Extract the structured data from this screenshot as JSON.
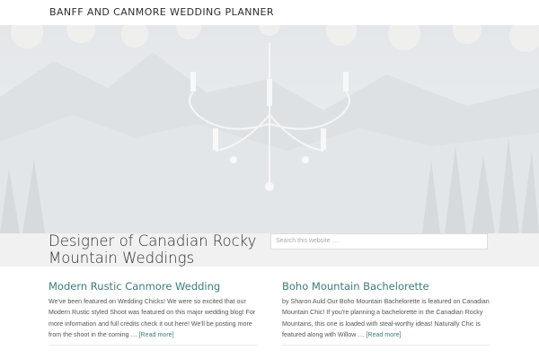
{
  "site": {
    "title": "BANFF AND CANMORE WEDDING PLANNER"
  },
  "intro": {
    "tagline": "Designer of Canadian Rocky Mountain Weddings",
    "search_placeholder": "Search this website …"
  },
  "posts": [
    {
      "title": "Modern Rustic Canmore Wedding",
      "excerpt": "We've been featured on Wedding Chicks! We were so excited that our Modern Rustic styled Shoot was featured on this major wedding blog! For more information and full credits check it out here! We'll be posting more from the shoot in the coming …",
      "read_more": "[Read more]"
    },
    {
      "title": "Boho Mountain Bachelorette",
      "excerpt": "by Sharon Auld Our Boho Mountain Bachelorette is featured on Canadian Mountain Chic! If you're planning a bachelorette in the Canadian Rocky Mountains, this one is loaded with steal-worthy ideas! Naturally Chic is featured along with Willow …",
      "read_more": "[Read more]"
    }
  ],
  "colors": {
    "accent": "#3b7d7a",
    "intro_band": "#f1f1f1"
  },
  "hero": {
    "image": "chandelier-mountain-photo"
  }
}
